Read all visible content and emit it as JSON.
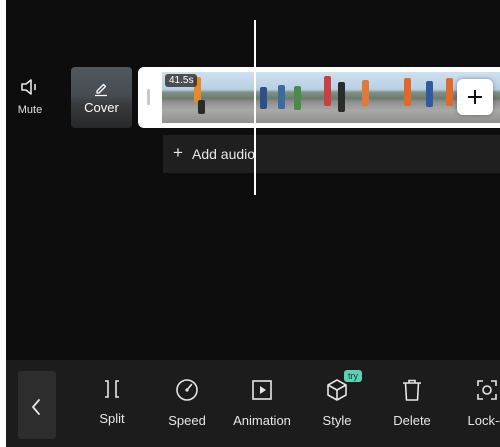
{
  "timeline": {
    "mute_label": "Mute",
    "cover_label": "Cover",
    "clip_duration": "41.5s",
    "add_audio_label": "Add audio"
  },
  "toolbar": {
    "tools": [
      {
        "label": "Split",
        "icon": "split-icon"
      },
      {
        "label": "Speed",
        "icon": "speedometer-icon"
      },
      {
        "label": "Animation",
        "icon": "play-square-icon"
      },
      {
        "label": "Style",
        "icon": "cube-icon",
        "badge": "try"
      },
      {
        "label": "Delete",
        "icon": "trash-icon"
      },
      {
        "label": "Lock-o",
        "icon": "lock-on-icon"
      }
    ]
  },
  "colors": {
    "background": "#0d0d0d",
    "toolbar": "#1c1c1c",
    "badge": "#5ed1b5"
  }
}
